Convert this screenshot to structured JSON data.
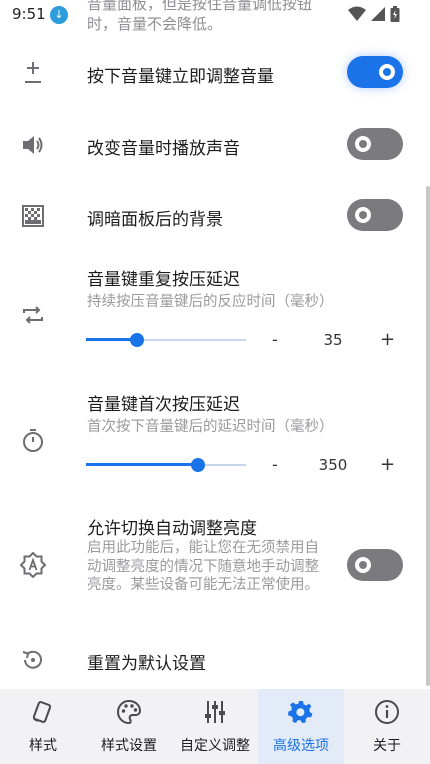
{
  "status_bar": {
    "time": "9:51",
    "notification_icon": "download-icon",
    "icons": [
      "wifi-icon",
      "cellular-icon",
      "battery-icon"
    ]
  },
  "top_partial_text": "音量面板，但是按住音量调低按钮时，音量不会降低。",
  "settings": [
    {
      "title": "按下音量键立即调整音量",
      "icon": "plus-minus-icon",
      "toggle": true
    },
    {
      "title": "改变音量时播放声音",
      "icon": "speaker-icon",
      "toggle": false
    },
    {
      "title": "调暗面板后的背景",
      "icon": "dim-background-icon",
      "toggle": false
    }
  ],
  "repeat_delay": {
    "title": "音量键重复按压延迟",
    "subtitle": "持续按压音量键后的反应时间（毫秒）",
    "icon": "repeat-icon",
    "minus": "-",
    "value": "35",
    "plus": "+",
    "slider_fraction": 0.32
  },
  "first_delay": {
    "title": "音量键首次按压延迟",
    "subtitle": "首次按下音量键后的延迟时间（毫秒）",
    "icon": "timer-icon",
    "minus": "-",
    "value": "350",
    "plus": "+",
    "slider_fraction": 0.7
  },
  "auto_brightness": {
    "title": "允许切换自动调整亮度",
    "description": "启用此功能后，能让您在无须禁用自动调整亮度的情况下随意地手动调整亮度。某些设备可能无法正常使用。",
    "icon": "auto-brightness-icon",
    "toggle": false
  },
  "reset": {
    "title": "重置为默认设置",
    "icon": "reset-icon"
  },
  "nav": [
    {
      "label": "样式",
      "icon": "style-icon",
      "active": false
    },
    {
      "label": "样式设置",
      "icon": "palette-icon",
      "active": false
    },
    {
      "label": "自定义调整",
      "icon": "sliders-icon",
      "active": false
    },
    {
      "label": "高级选项",
      "icon": "gear-icon",
      "active": true
    },
    {
      "label": "关于",
      "icon": "info-icon",
      "active": false
    }
  ],
  "colors": {
    "accent": "#1a73e8",
    "toggle_off": "#7b7b7f",
    "nav_background": "#f2f2f4"
  }
}
